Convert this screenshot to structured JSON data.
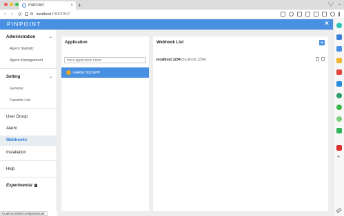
{
  "browser": {
    "tab_title": "PINPOINT",
    "tab_close": "×",
    "new_tab": "+",
    "url_host": "localhost",
    "url_brand": "PINPOINT",
    "nav_back": "‹",
    "nav_forward": "›",
    "nav_reload": "⟳",
    "window_chevron": "⌄",
    "status_url": "localhost:8080/config/webhook"
  },
  "header": {
    "brand": "PINPOINT",
    "close_icon": "×",
    "color": "#4a90e2"
  },
  "sidebar": {
    "administration": {
      "label": "Administration",
      "items": [
        "Agent Statistic",
        "Agent Management"
      ]
    },
    "setting": {
      "label": "Setting",
      "items": [
        "General",
        "Favorite List"
      ]
    },
    "items": [
      "User Group",
      "Alarm",
      "Webhooks",
      "Installation",
      "Help"
    ],
    "active": "Webhooks",
    "experimental": "Experimental"
  },
  "application_panel": {
    "title": "Application",
    "search_placeholder": "Input application name",
    "apps": [
      {
        "name": "GARM-TESTAPP",
        "selected": true
      }
    ]
  },
  "webhook_panel": {
    "title": "Webhook List",
    "add_label": "+",
    "webhooks": [
      {
        "host": "localhost:1234",
        "alias": "(localhost:1234)"
      }
    ]
  }
}
